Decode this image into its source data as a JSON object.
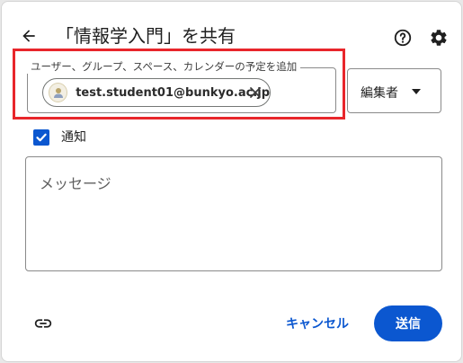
{
  "dialog": {
    "title": "「情報学入門」を共有"
  },
  "people": {
    "label": "ユーザー、グループ、スペース、カレンダーの予定を追加",
    "chip_email": "test.student01@bunkyo.ac.jp"
  },
  "role": {
    "selected": "編集者"
  },
  "notify": {
    "label": "通知",
    "checked": true
  },
  "message": {
    "placeholder": "メッセージ"
  },
  "footer": {
    "cancel_label": "キャンセル",
    "send_label": "送信"
  },
  "icons": {
    "back": "arrow-back-icon",
    "help": "help-circle-icon",
    "settings": "gear-icon",
    "close": "close-icon",
    "dropdown": "caret-down-icon",
    "check": "check-icon",
    "link": "link-icon"
  },
  "colors": {
    "accent": "#0b57d0",
    "highlight": "#e8262b"
  }
}
